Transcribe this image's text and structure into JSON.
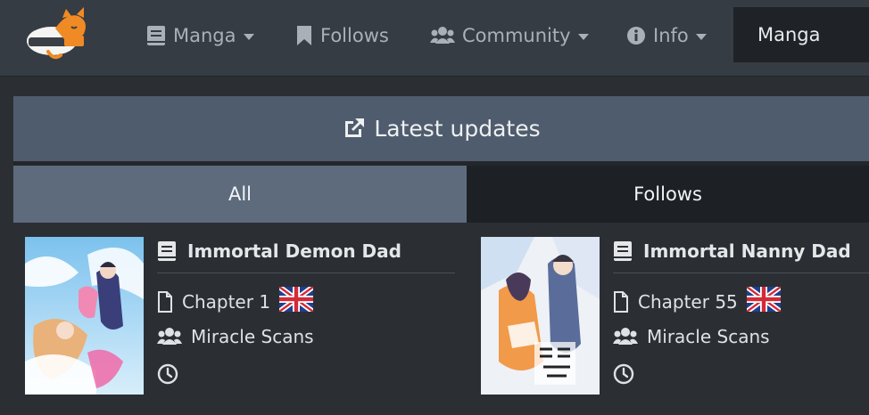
{
  "nav": {
    "manga_label": "Manga",
    "follows_label": "Follows",
    "community_label": "Community",
    "info_label": "Info",
    "search_value": "Manga"
  },
  "panel": {
    "header_title": "Latest updates",
    "tabs": [
      {
        "label": "All",
        "active": true
      },
      {
        "label": "Follows",
        "active": false
      }
    ]
  },
  "updates": [
    {
      "title": "Immortal Demon Dad",
      "chapter": "Chapter 1",
      "language_flag": "uk-flag",
      "group": "Miracle Scans",
      "time": ""
    },
    {
      "title": "Immortal Nanny Dad",
      "chapter": "Chapter 55",
      "language_flag": "uk-flag",
      "group": "Miracle Scans",
      "time": ""
    }
  ],
  "colors": {
    "navbar": "#363c44",
    "panel_header": "#4f5c6d",
    "tab_active": "#5d6b7d",
    "tab_inactive": "#1d2024",
    "logo_orange": "#f08a24"
  }
}
